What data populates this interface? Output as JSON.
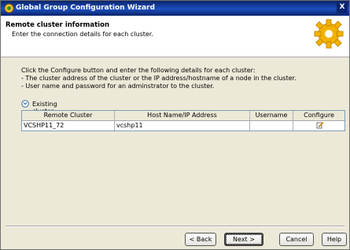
{
  "window": {
    "title": "Global Group Configuration Wizard",
    "close_label": "X"
  },
  "header": {
    "title": "Remote cluster information",
    "subtitle": "Enter the connection details for each cluster."
  },
  "intro": {
    "line1": "Click the Configure button and enter the following details for each cluster:",
    "line2": "- The cluster address of the cluster or the IP address/hostname of a node in the cluster.",
    "line3": "- User name and password for an adminstrator to the cluster."
  },
  "section": {
    "label": "Existing cluster configuration details"
  },
  "table": {
    "columns": [
      "Remote Cluster",
      "Host Name/IP Address",
      "Username",
      "Configure"
    ],
    "rows": [
      {
        "remote_cluster": "VCSHP11_72",
        "host": "vcshp11",
        "username": ""
      }
    ]
  },
  "buttons": {
    "back": "< Back",
    "next": "Next >",
    "cancel": "Cancel",
    "help": "Help"
  },
  "icons": {
    "app": "globe-cluster-icon",
    "header": "gear-icon",
    "section": "expand-circle-icon",
    "configure": "edit-icon"
  },
  "colors": {
    "titlebar": "#0a246a",
    "panel": "#ece9d8",
    "gear": "#f2b200"
  }
}
